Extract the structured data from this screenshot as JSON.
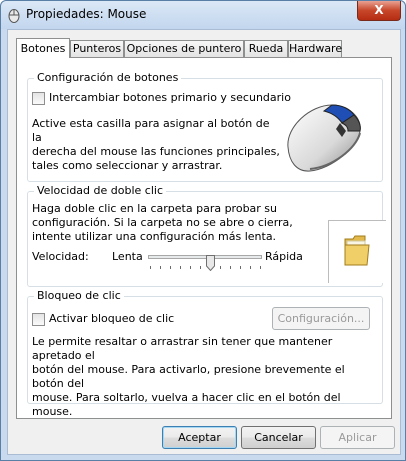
{
  "window": {
    "title": "Propiedades: Mouse",
    "close_label": "X"
  },
  "tabs": [
    {
      "label": "Botones",
      "active": true
    },
    {
      "label": "Punteros",
      "active": false
    },
    {
      "label": "Opciones de puntero",
      "active": false
    },
    {
      "label": "Rueda",
      "active": false
    },
    {
      "label": "Hardware",
      "active": false
    }
  ],
  "button_config": {
    "title": "Configuración de botones",
    "swap_checkbox_label": "Intercambiar botones primario y secundario",
    "swap_checked": false,
    "description": "Active esta casilla para asignar al botón de la\nderecha del mouse las funciones principales,\ntales como seleccionar y arrastrar."
  },
  "double_click": {
    "title": "Velocidad de doble clic",
    "description": "Haga doble clic en la carpeta para probar su\nconfiguración. Si la carpeta no se abre o cierra,\nintente utilizar una configuración más lenta.",
    "speed_label": "Velocidad:",
    "slow_label": "Lenta",
    "fast_label": "Rápida",
    "slider_value": 0.55,
    "folder_icon": "folder-icon"
  },
  "click_lock": {
    "title": "Bloqueo de clic",
    "checkbox_label": "Activar bloqueo de clic",
    "checked": false,
    "settings_button": "Configuración...",
    "description": "Le permite resaltar o arrastrar sin tener que mantener apretado el\nbotón del mouse. Para activarlo, presione brevemente el botón del\nmouse. Para soltarlo, vuelva a hacer clic en el botón del mouse."
  },
  "buttons": {
    "ok": "Aceptar",
    "cancel": "Cancelar",
    "apply": "Aplicar"
  },
  "colors": {
    "accent": "#3c7fb1",
    "close": "#c7462a",
    "frame": "#c9daee"
  }
}
